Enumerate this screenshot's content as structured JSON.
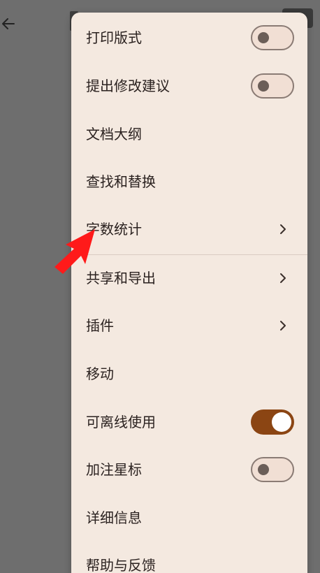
{
  "header": {
    "back_icon": "arrow-left-icon"
  },
  "menu": {
    "items": [
      {
        "label": "打印版式",
        "control": "toggle",
        "state": "off"
      },
      {
        "label": "提出修改建议",
        "control": "toggle",
        "state": "off"
      },
      {
        "label": "文档大纲",
        "control": "none"
      },
      {
        "label": "查找和替换",
        "control": "none"
      },
      {
        "label": "字数统计",
        "control": "chevron"
      },
      {
        "label": "共享和导出",
        "control": "chevron"
      },
      {
        "label": "插件",
        "control": "chevron"
      },
      {
        "label": "移动",
        "control": "none"
      },
      {
        "label": "可离线使用",
        "control": "toggle",
        "state": "on"
      },
      {
        "label": "加注星标",
        "control": "toggle",
        "state": "off"
      },
      {
        "label": "详细信息",
        "control": "none"
      },
      {
        "label": "帮助与反馈",
        "control": "none"
      }
    ]
  },
  "colors": {
    "menu_background": "#f4e9e0",
    "toggle_on": "#8b4513",
    "overlay": "#6e6e6e",
    "annotation_arrow": "#ff1a1a"
  }
}
